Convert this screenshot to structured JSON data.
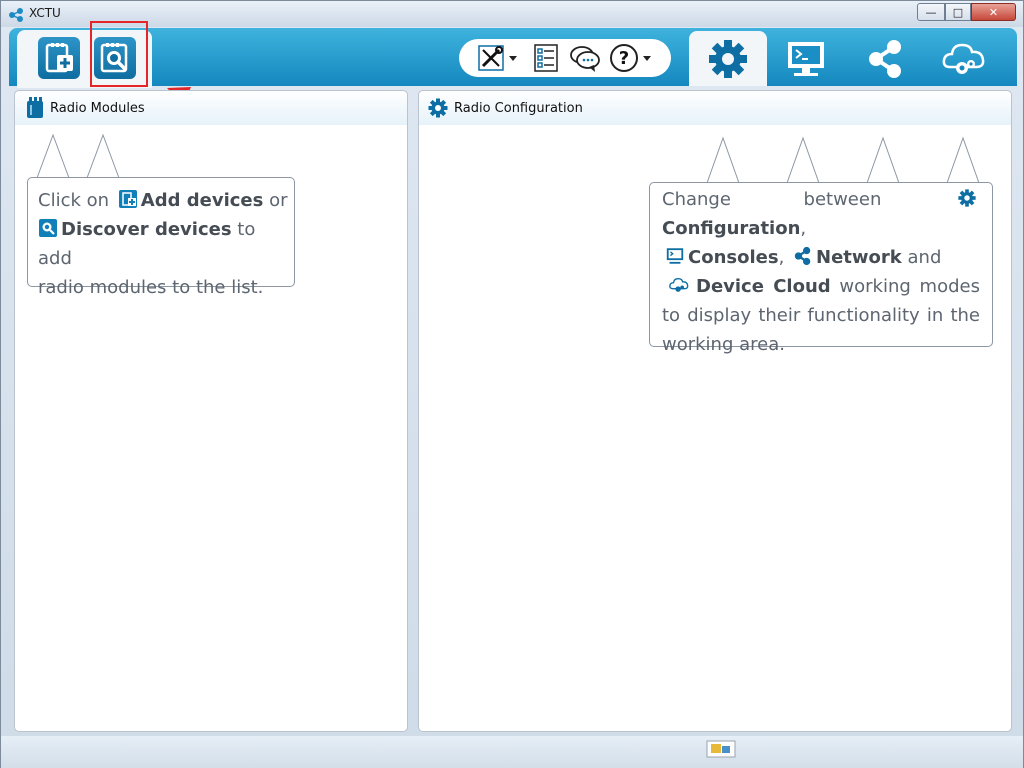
{
  "window": {
    "title": "XCTU"
  },
  "toolbar": {
    "left_buttons": [
      {
        "name": "add-devices",
        "icon": "add-device-icon"
      },
      {
        "name": "discover-devices",
        "icon": "discover-device-icon"
      }
    ],
    "tools": [
      {
        "icon": "tools-icon",
        "has_dropdown": true
      },
      {
        "icon": "frames-list-icon",
        "has_dropdown": false
      },
      {
        "icon": "feedback-chat-icon",
        "has_dropdown": false
      },
      {
        "icon": "help-icon",
        "has_dropdown": true
      }
    ],
    "modes": [
      {
        "name": "configuration",
        "icon": "gear-icon",
        "active": true
      },
      {
        "name": "consoles",
        "icon": "monitor-console-icon",
        "active": false
      },
      {
        "name": "network",
        "icon": "network-nodes-icon",
        "active": false
      },
      {
        "name": "device-cloud",
        "icon": "cloud-gear-icon",
        "active": false
      }
    ]
  },
  "left_panel": {
    "title": "Radio Modules",
    "hint": {
      "line1_pre": "Click on",
      "add_label": "Add devices",
      "line1_post": "or",
      "discover_label": "Discover devices",
      "line2_post": "to add",
      "line3": "radio modules to the list."
    }
  },
  "right_panel": {
    "title": "Radio Configuration",
    "hint": {
      "pre": "Change between",
      "configuration": "Configuration",
      "comma1": ",",
      "consoles": "Consoles",
      "comma2": ",",
      "network": "Network",
      "and": "and",
      "device_cloud": "Device Cloud",
      "post1": "working modes",
      "post2": "to display their functionality in",
      "post3": "the working area."
    }
  },
  "colors": {
    "toolbar_top": "#3fb3dd",
    "toolbar_bottom": "#1487bf",
    "icon_blue": "#0e6ea3",
    "annotation_red": "#e4262a"
  }
}
